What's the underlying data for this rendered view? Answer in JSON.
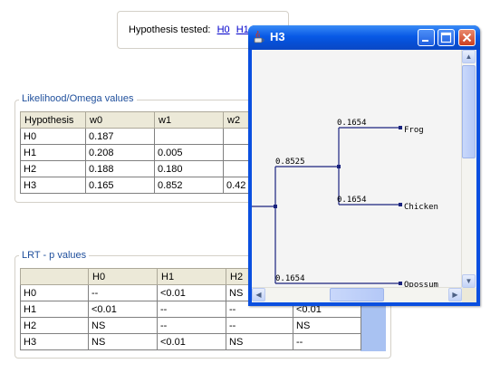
{
  "hypothesis_panel": {
    "label": "Hypothesis tested:",
    "links": [
      "H0",
      "H1"
    ]
  },
  "likelihood": {
    "title": "Likelihood/Omega values",
    "columns": [
      "Hypothesis",
      "w0",
      "w1",
      "w2"
    ],
    "rows": [
      [
        "H0",
        "0.187",
        "",
        ""
      ],
      [
        "H1",
        "0.208",
        "0.005",
        ""
      ],
      [
        "H2",
        "0.188",
        "0.180",
        ""
      ],
      [
        "H3",
        "0.165",
        "0.852",
        "0.42"
      ]
    ]
  },
  "lrt": {
    "title": "LRT - p values",
    "columns": [
      "",
      "H0",
      "H1",
      "H2",
      ""
    ],
    "rows": [
      [
        "H0",
        "--",
        "<0.01",
        "NS",
        ""
      ],
      [
        "H1",
        "<0.01",
        "--",
        "--",
        "<0.01"
      ],
      [
        "H2",
        "NS",
        "--",
        "--",
        "NS"
      ],
      [
        "H3",
        "NS",
        "<0.01",
        "NS",
        "--"
      ]
    ]
  },
  "window": {
    "title": "H3",
    "accent": "#0a4fe0",
    "tree": {
      "branch_color": "#1a237e",
      "taxa": [
        "Frog",
        "Chicken",
        "Opossum"
      ],
      "branch_lengths": {
        "internal": "0.8525",
        "frog": "0.1654",
        "chicken": "0.1654",
        "opossum": "0.1654"
      }
    }
  }
}
